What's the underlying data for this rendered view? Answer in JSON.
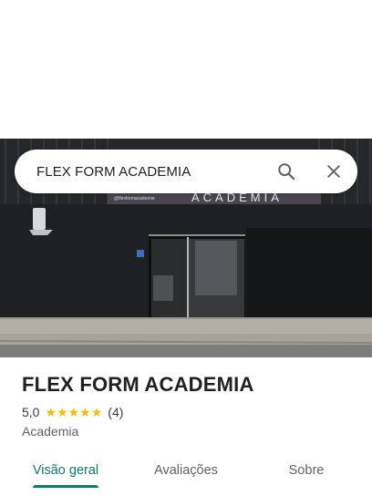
{
  "search": {
    "query": "FLEX FORM ACADEMIA",
    "search_icon": "search-icon",
    "close_icon": "close-icon"
  },
  "photo": {
    "sign_text": "ACADEMIA",
    "sign_small_text": "@flexformacademia"
  },
  "place": {
    "title": "FLEX FORM ACADEMIA",
    "rating": "5,0",
    "stars": 5,
    "review_count": "(4)",
    "category": "Academia"
  },
  "tabs": [
    {
      "label": "Visão geral",
      "active": true
    },
    {
      "label": "Avaliações",
      "active": false
    },
    {
      "label": "Sobre",
      "active": false
    }
  ],
  "colors": {
    "accent": "#0b7a75",
    "star": "#fbbc04"
  }
}
